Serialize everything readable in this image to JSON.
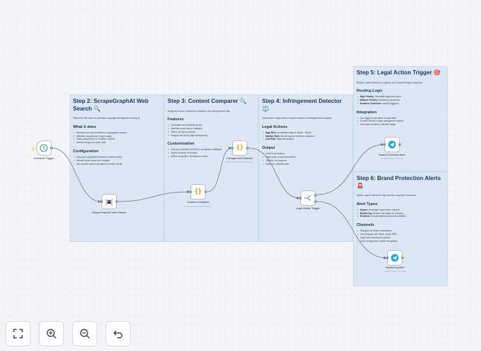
{
  "canvas": {
    "colors": {
      "sticky": "#dbe7f5",
      "wire": "#6b6f7a",
      "node_border": "#b9bcc6",
      "trigger_accent": "#ff6d5a"
    }
  },
  "steps": [
    {
      "title": "Step 2: ScrapeGraphAI Web Search 🔍",
      "desc": "Searches the web for potential copyright infringement using AI.",
      "sections": [
        {
          "heading": "What it does",
          "items": [
            {
              "text": "Searches for exact matches of copyrighted content"
            },
            {
              "text": "Identifies unauthorized brand usage"
            },
            {
              "text": "Finds paraphrased or modified content"
            },
            {
              "text": "Detects image and video theft"
            }
          ]
        },
        {
          "heading": "Configuration",
          "items": [
            {
              "text": "Add your copyrighted phrases to search query"
            },
            {
              "text": "Include brand names and slogans"
            },
            {
              "text": "Use specific search operators for better results"
            }
          ]
        }
      ]
    },
    {
      "title": "Step 3: Content Comparer 🔍",
      "desc": "Analyzes found content for similarity and infringement risk.",
      "sections": [
        {
          "heading": "Features",
          "items": [
            {
              "text": "Calculates text similarity scores"
            },
            {
              "text": "Identifies brand name violations"
            },
            {
              "text": "Filters out false positives"
            },
            {
              "text": "Assigns risk levels (high/medium/low)"
            }
          ]
        },
        {
          "heading": "Customization",
          "items": [
            {
              "text": "Add your protected content to comparison database"
            },
            {
              "text": "Adjust similarity thresholds"
            },
            {
              "text": "Define competitor domains to monitor"
            }
          ]
        }
      ]
    },
    {
      "title": "Step 4: Infringement Detector ⚖️",
      "desc": "Determines legal action required based on infringement analysis.",
      "sections": [
        {
          "heading": "Legal Actions",
          "items": [
            {
              "bold": "High Risk:",
              "text": " Immediate cease & desist + DMCA"
            },
            {
              "bold": "Medium Risk:",
              "text": " Monitoring and evidence collection"
            },
            {
              "bold": "Low Risk:",
              "text": " Watchlist addition"
            }
          ]
        },
        {
          "heading": "Output",
          "items": [
            {
              "text": "Case ID generation"
            },
            {
              "text": "Legal action recommendations"
            },
            {
              "text": "Timeline for response"
            },
            {
              "text": "Evidence collection plan"
            }
          ]
        }
      ]
    },
    {
      "title": "Step 5: Legal Action Trigger 🎯",
      "desc": "Routes cases based on urgency and required legal response.",
      "sections": [
        {
          "heading": "Routing Logic",
          "items": [
            {
              "bold": "High Priority:",
              "text": " Immediate legal team alert"
            },
            {
              "bold": "Medium Priority:",
              "text": " Monitoring dashboard"
            },
            {
              "bold": "Evidence Collection:",
              "text": " Always triggered"
            }
          ]
        },
        {
          "heading": "Integration",
          "items": [
            {
              "text": "Can trigger email alerts to legal team"
            },
            {
              "text": "Creates tickets in legal management system"
            },
            {
              "text": "Generates evidence collection tasks"
            }
          ]
        }
      ]
    },
    {
      "title": "Step 6: Brand Protection Alerts 🚨",
      "desc": "Sends urgent alerts for high-priority copyright violations.",
      "sections": [
        {
          "heading": "Alert Types",
          "items": [
            {
              "bold": "Urgent:",
              "text": " Immediate legal action required"
            },
            {
              "bold": "Monitoring:",
              "text": " Medium risk cases for tracking"
            },
            {
              "bold": "Evidence:",
              "text": " Documentation and proof collection"
            }
          ]
        },
        {
          "heading": "Channels",
          "items": [
            {
              "text": "Telegram for instant notifications"
            },
            {
              "text": "Can integrate with Slack, email, SMS"
            },
            {
              "text": "Legal team dashboard updates"
            },
            {
              "text": "Case management system integration"
            }
          ]
        }
      ]
    }
  ],
  "nodes": [
    {
      "label": "Schedule Trigger",
      "sub": "",
      "icon": "clock-icon"
    },
    {
      "label": "ScrapeGraphAI Web Search",
      "sub": "",
      "icon": "spider-icon"
    },
    {
      "label": "Content Comparer",
      "sub": "Analyzes potential infringem...",
      "icon": "code-icon"
    },
    {
      "label": "Infringement Detector",
      "sub": "Determines legal action need...",
      "icon": "code-icon"
    },
    {
      "label": "Legal Action Trigger",
      "sub": "",
      "icon": "route-icon"
    },
    {
      "label": "Brand Protection Alert",
      "sub": "sendMessage: message",
      "icon": "telegram-icon"
    },
    {
      "label": "Monitoring Alert",
      "sub": "sendMessage: message",
      "icon": "telegram-icon"
    }
  ],
  "toolbar": [
    {
      "name": "fit-view-button",
      "icon": "fit-view-icon"
    },
    {
      "name": "zoom-in-button",
      "icon": "zoom-in-icon"
    },
    {
      "name": "zoom-out-button",
      "icon": "zoom-out-icon"
    },
    {
      "name": "reset-zoom-button",
      "icon": "undo-icon"
    }
  ]
}
